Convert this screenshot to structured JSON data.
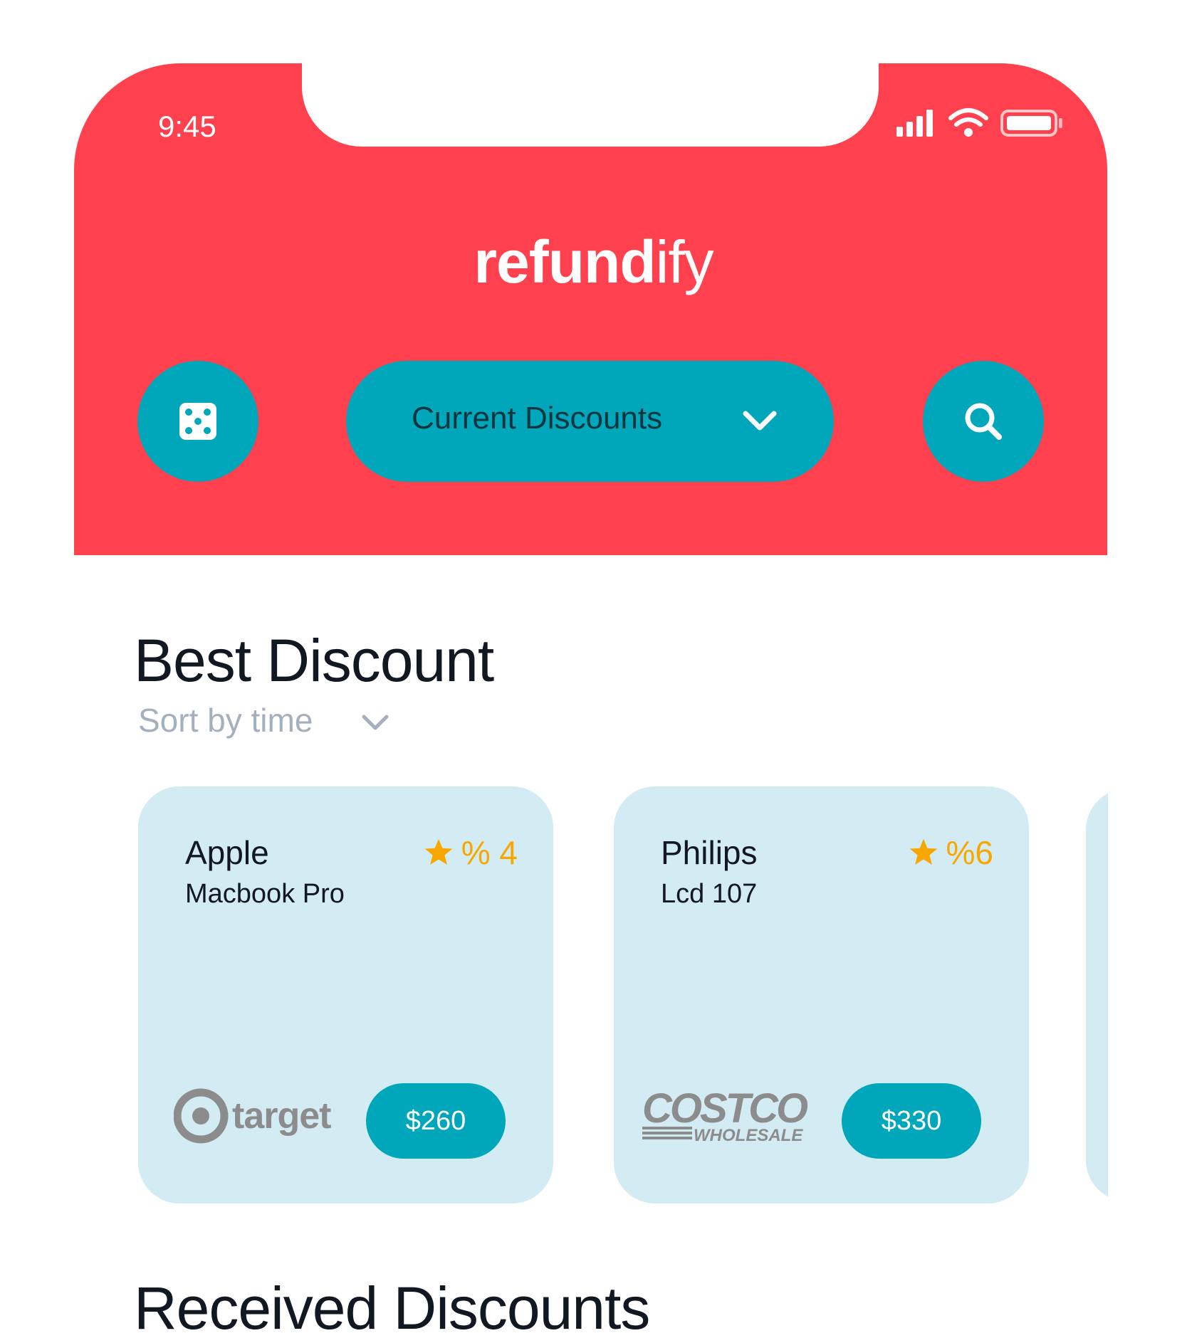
{
  "status_bar": {
    "time": "9:45"
  },
  "app": {
    "name_bold": "refund",
    "name_regular": "ify"
  },
  "toolbar": {
    "category_label": "Current Discounts"
  },
  "best_discount": {
    "title": "Best Discount",
    "sort_label": "Sort by time",
    "cards": [
      {
        "brand": "Apple",
        "model": "Macbook Pro",
        "rating": "% 4",
        "price": "$260",
        "store": "target"
      },
      {
        "brand": "Philips",
        "model": "Lcd 107",
        "rating": "%6",
        "price": "$330",
        "store": "COSTCO",
        "store_sub": "WHOLESALE"
      }
    ]
  },
  "received_discounts": {
    "title": "Received Discounts"
  },
  "colors": {
    "header": "#ff404e",
    "accent": "#00a6b9",
    "card_bg": "#d3ebf2",
    "rating": "#f7a700"
  },
  "icons": [
    "dice-icon",
    "search-icon",
    "chevron-down-icon",
    "star-icon",
    "signal-icon",
    "wifi-icon",
    "battery-icon"
  ]
}
